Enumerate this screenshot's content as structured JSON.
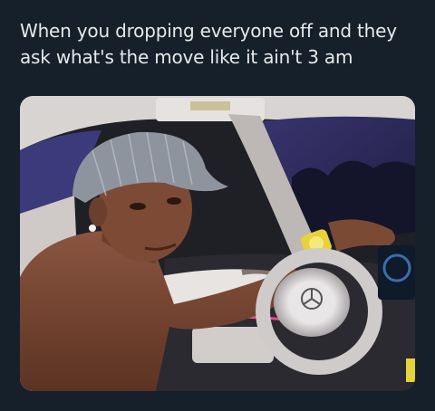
{
  "post": {
    "caption_lines": [
      "When you dropping everyone off and they",
      "ask what's the move like it ain't 3 am"
    ]
  },
  "photo": {
    "subject": "shirtless man in striped cap seated in car driver seat, hand on steering wheel",
    "palette": {
      "night_sky": "#2c2a5a",
      "interior_light": "#d9d4d0",
      "skin": "#7a4a35",
      "cap": "#8e949e",
      "watch": "#e6d23a",
      "ambient_pink": "#e84a8a"
    }
  }
}
